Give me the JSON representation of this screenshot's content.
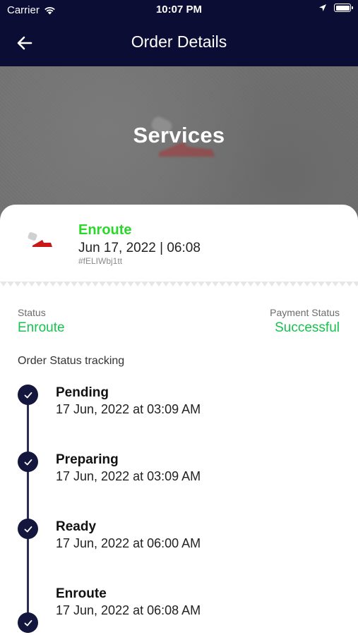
{
  "status_bar": {
    "carrier": "Carrier",
    "time": "10:07 PM"
  },
  "header": {
    "title": "Order Details"
  },
  "hero": {
    "title": "Services"
  },
  "order": {
    "status": "Enroute",
    "date": "Jun 17, 2022 | 06:08",
    "id": "#fELIWbj1tt"
  },
  "summary": {
    "status_label": "Status",
    "status_value": "Enroute",
    "payment_label": "Payment Status",
    "payment_value": "Successful"
  },
  "tracking": {
    "title": "Order Status tracking",
    "steps": [
      {
        "name": "Pending",
        "time": "17 Jun, 2022 at 03:09 AM"
      },
      {
        "name": "Preparing",
        "time": "17 Jun, 2022 at 03:09 AM"
      },
      {
        "name": "Ready",
        "time": "17 Jun, 2022 at 06:00 AM"
      },
      {
        "name": "Enroute",
        "time": "17 Jun, 2022 at 06:08 AM"
      }
    ]
  },
  "colors": {
    "header_bg": "#0b0d34",
    "status_green": "#17c24e",
    "order_status_green": "#2ad82a",
    "timeline_dot": "#14163d"
  }
}
